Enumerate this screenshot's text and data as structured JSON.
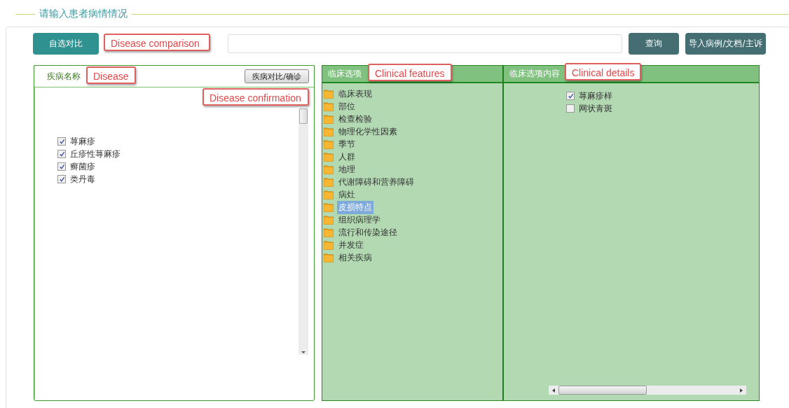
{
  "section_title": "请输入患者病情情况",
  "toolbar": {
    "compare_button": "自选对比",
    "query_button": "查询",
    "import_button": "导入病例/文档/主诉"
  },
  "disease_panel": {
    "title": "疾病名称",
    "confirm_button": "疾病对比/确诊",
    "items": [
      {
        "label": "荨麻疹",
        "checked": true
      },
      {
        "label": "丘疹性荨麻疹",
        "checked": true
      },
      {
        "label": "癣菌疹",
        "checked": true
      },
      {
        "label": "类丹毒",
        "checked": true
      }
    ]
  },
  "features_panel": {
    "title": "临床选项",
    "items": [
      {
        "label": "临床表现",
        "selected": false
      },
      {
        "label": "部位",
        "selected": false
      },
      {
        "label": "检查检验",
        "selected": false
      },
      {
        "label": "物理化学性因素",
        "selected": false
      },
      {
        "label": "季节",
        "selected": false
      },
      {
        "label": "人群",
        "selected": false
      },
      {
        "label": "地理",
        "selected": false
      },
      {
        "label": "代谢障碍和营养障碍",
        "selected": false
      },
      {
        "label": "病灶",
        "selected": false
      },
      {
        "label": "皮损特点",
        "selected": true
      },
      {
        "label": "组织病理学",
        "selected": false
      },
      {
        "label": "流行和传染途径",
        "selected": false
      },
      {
        "label": "并发症",
        "selected": false
      },
      {
        "label": "相关疾病",
        "selected": false
      }
    ]
  },
  "details_panel": {
    "title": "临床选项内容",
    "items": [
      {
        "label": "荨麻疹样",
        "checked": true
      },
      {
        "label": "网状青斑",
        "checked": false
      }
    ]
  },
  "annotations": [
    "Disease comparison",
    "Disease",
    "Disease confirmation",
    "Clinical features",
    "Clinical details"
  ]
}
